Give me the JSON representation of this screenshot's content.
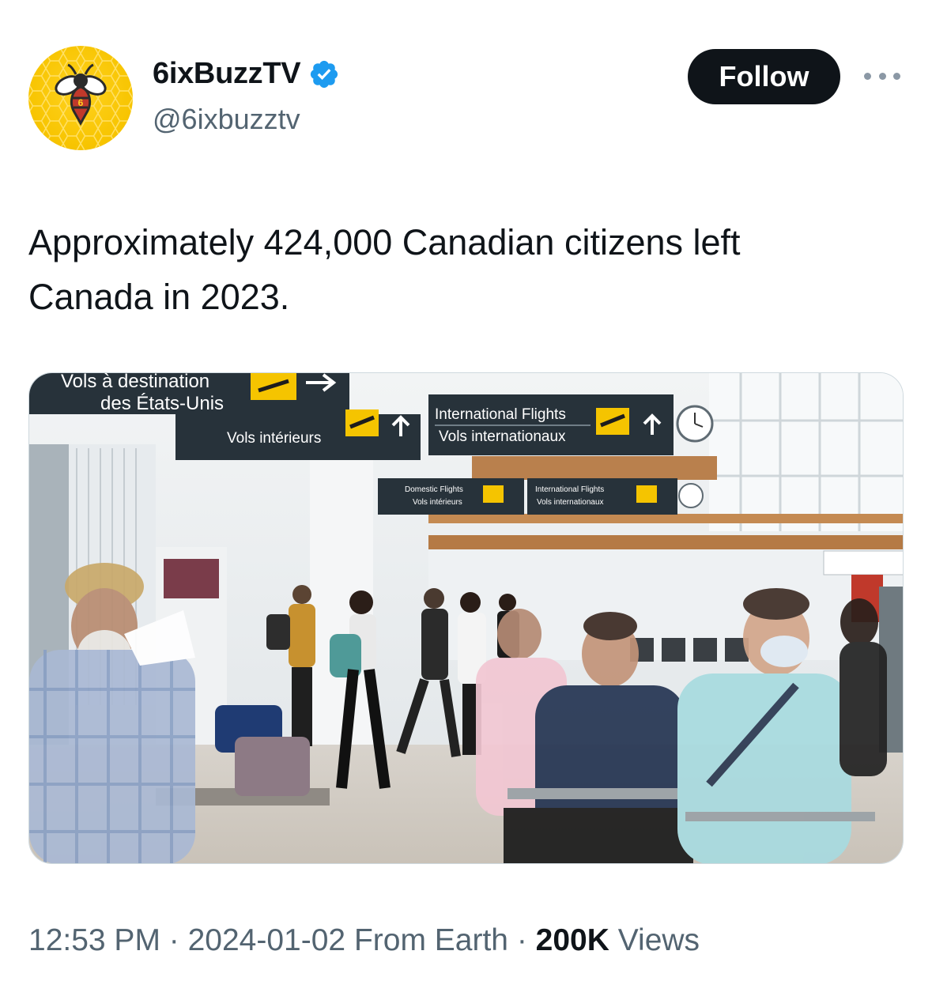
{
  "author": {
    "display_name": "6ixBuzzTV",
    "handle": "@6ixbuzztv",
    "verified": true,
    "avatar_icon": "bee-logo-icon",
    "avatar_badge_text": "6",
    "accent_color": "#1d9bf0"
  },
  "actions": {
    "follow_label": "Follow",
    "more_icon": "more-dots-icon"
  },
  "tweet": {
    "text": "Approximately 424,000 Canadian citizens left\nCanada in 2023."
  },
  "media": {
    "type": "photo",
    "signs": {
      "top_left_line1": "Vols à destination",
      "top_left_line2": "des États-Unis",
      "domestic_fr": "Vols intérieurs",
      "intl_en": "International Flights",
      "intl_fr": "Vols internationaux",
      "small_domestic_en": "Domestic Flights",
      "small_domestic_fr": "Vols intérieurs",
      "small_intl_en": "International Flights",
      "small_intl_fr": "Vols internationaux"
    }
  },
  "meta": {
    "time": "12:53 PM",
    "sep1": " · ",
    "date": "2024-01-02",
    "source": " From Earth",
    "sep2": " · ",
    "views_count": "200K",
    "views_label": " Views"
  }
}
